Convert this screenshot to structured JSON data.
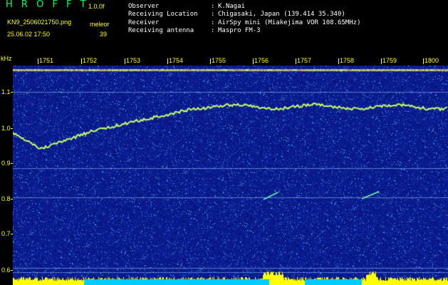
{
  "header": {
    "app_title": "H R O F F T",
    "version": "1.0.0f",
    "filename": "KN9_2506021750.png",
    "meteor_label": "meleor",
    "datetime": "25.06.02 17:50",
    "meteor_count": "39"
  },
  "info": [
    {
      "label": "Observer",
      "value": "K.Nagai"
    },
    {
      "label": "Receiving Location",
      "value": "Chigasaki, Japan (139.414 35.340)"
    },
    {
      "label": "Receiver",
      "value": "AirSpy mini (Miakejima VOR 108.65MHz)"
    },
    {
      "label": "Receiving antenna",
      "value": "Maspro FM-3"
    }
  ],
  "info_separator": ":",
  "axis": {
    "y_unit": "kHz",
    "x_ticks": [
      "1751",
      "1752",
      "1753",
      "1754",
      "1755",
      "1756",
      "1757",
      "1758",
      "1759",
      "1800"
    ],
    "y_ticks": [
      "1.1",
      "1.0",
      "0.9",
      "0.8",
      "0.7",
      "0.6"
    ]
  },
  "colors": {
    "background": "#000000",
    "text": "#ffffff",
    "title": "#00ff66",
    "yellow": "#ffff00",
    "noise_bg": "#0a1a8c"
  }
}
